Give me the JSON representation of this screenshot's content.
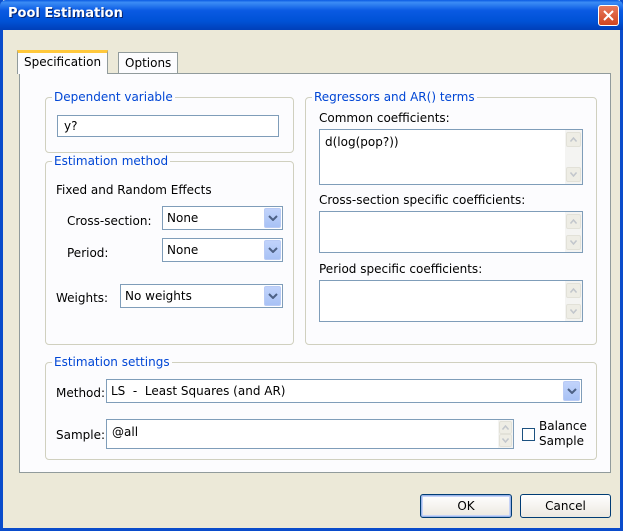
{
  "window": {
    "title": "Pool Estimation"
  },
  "tabs": [
    {
      "label": "Specification"
    },
    {
      "label": "Options"
    }
  ],
  "dependent": {
    "legend": "Dependent variable",
    "value": "y?"
  },
  "estimation_method": {
    "legend": "Estimation method",
    "effects_heading": "Fixed and Random Effects",
    "cross_section": {
      "label": "Cross-section:",
      "value": "None"
    },
    "period": {
      "label": "Period:",
      "value": "None"
    },
    "weights": {
      "label": "Weights:",
      "value": "No weights"
    }
  },
  "regressors": {
    "legend": "Regressors and AR() terms",
    "common": {
      "label": "Common coefficients:",
      "value": "d(log(pop?))"
    },
    "cross_section_specific": {
      "label": "Cross-section specific coefficients:",
      "value": ""
    },
    "period_specific": {
      "label": "Period specific coefficients:",
      "value": ""
    }
  },
  "settings": {
    "legend": "Estimation settings",
    "method": {
      "label": "Method:",
      "value": "LS  -  Least Squares (and AR)"
    },
    "sample": {
      "label": "Sample:",
      "value": "@all"
    },
    "balance": {
      "label_line1": "Balance",
      "label_line2": "Sample",
      "checked": false
    }
  },
  "buttons": {
    "ok": "OK",
    "cancel": "Cancel"
  },
  "icons": {
    "close": "close-icon",
    "dropdown": "chevron-down-icon",
    "scroll_up": "arrow-up-icon",
    "scroll_down": "arrow-down-icon"
  },
  "colors": {
    "title_bar": "#0a5ae3",
    "group_legend": "#0046d5",
    "tab_highlight": "#ffc83c",
    "close_button": "#d0451f"
  }
}
